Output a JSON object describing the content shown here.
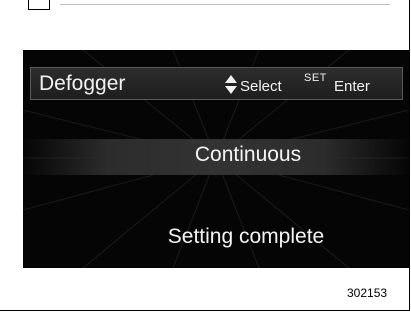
{
  "header": {
    "title": "Defogger",
    "select_hint": "Select",
    "set_hint": "SET",
    "enter_hint": "Enter"
  },
  "main": {
    "selected_option": "Continuous",
    "status": "Setting complete"
  },
  "figure_number": "302153",
  "icons": {
    "arrows": "up-down-arrows-icon"
  },
  "colors": {
    "screen_background": "#050505",
    "text": "#f2f2f2",
    "header_border": "#5a5a5a"
  }
}
